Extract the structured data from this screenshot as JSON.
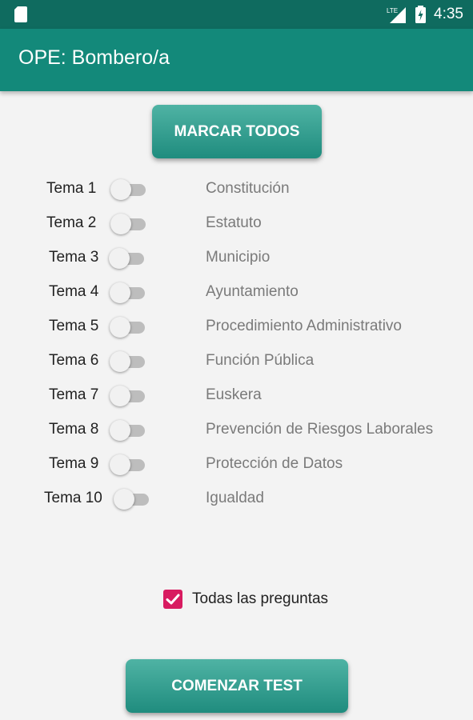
{
  "status_bar": {
    "network_label": "LTE",
    "time": "4:35",
    "icons": [
      "sd-card-icon",
      "signal-icon",
      "battery-charging-icon"
    ]
  },
  "app_bar": {
    "title": "OPE: Bombero/a"
  },
  "buttons": {
    "mark_all": "MARCAR TODOS",
    "start_test": "COMENZAR TEST"
  },
  "topics": [
    {
      "label": "Tema 1",
      "name": "Constitución",
      "enabled": false
    },
    {
      "label": "Tema 2",
      "name": "Estatuto",
      "enabled": false
    },
    {
      "label": "Tema 3",
      "name": "Municipio",
      "enabled": false
    },
    {
      "label": "Tema 4",
      "name": "Ayuntamiento",
      "enabled": false
    },
    {
      "label": "Tema 5",
      "name": "Procedimiento Administrativo",
      "enabled": false
    },
    {
      "label": "Tema 6",
      "name": "Función Pública",
      "enabled": false
    },
    {
      "label": "Tema 7",
      "name": "Euskera",
      "enabled": false
    },
    {
      "label": "Tema 8",
      "name": "Prevención de Riesgos Laborales",
      "enabled": false
    },
    {
      "label": "Tema 9",
      "name": "Protección de Datos",
      "enabled": false
    },
    {
      "label": "Tema 10",
      "name": "Igualdad",
      "enabled": false
    }
  ],
  "all_questions": {
    "label": "Todas las preguntas",
    "checked": true
  },
  "colors": {
    "status_bar": "#0f6b5f",
    "app_bar": "#13897a",
    "button": "#2e9b8c",
    "checkbox": "#d81b60"
  }
}
